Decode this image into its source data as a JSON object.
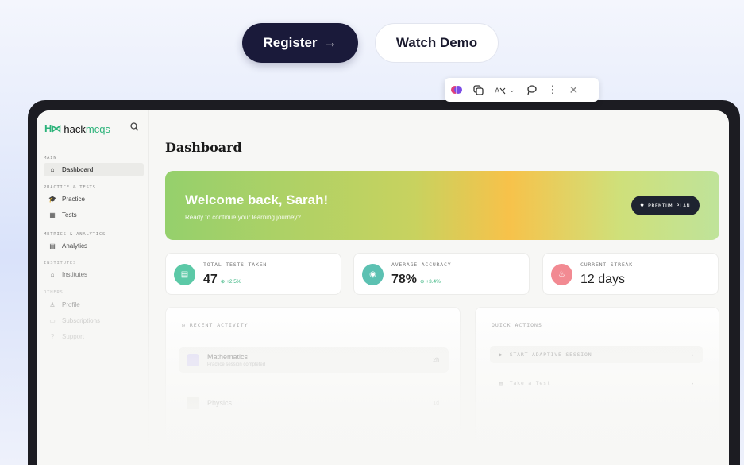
{
  "hero": {
    "register_label": "Register",
    "register_arrow": "→",
    "watch_demo_label": "Watch Demo"
  },
  "toolbar": {
    "icons": [
      "brain-icon",
      "copy-icon",
      "translate-icon",
      "chevron-down-icon",
      "lasso-icon",
      "more-icon",
      "close-icon"
    ]
  },
  "app": {
    "logo_mark": "H⋈",
    "logo_name_a": "hack",
    "logo_name_b": "mcqs",
    "sidebar": {
      "sections": {
        "main": "MAIN",
        "practice": "PRACTICE & TESTS",
        "metrics": "METRICS & ANALYTICS",
        "institutes": "INSTITUTES",
        "others": "OTHERS"
      },
      "items": {
        "dashboard": "Dashboard",
        "practice": "Practice",
        "tests": "Tests",
        "analytics": "Analytics",
        "institutes": "Institutes",
        "profile": "Profile",
        "subscriptions": "Subscriptions",
        "support": "Support"
      }
    },
    "page_title": "Dashboard",
    "welcome": {
      "title": "Welcome back, Sarah!",
      "subtitle": "Ready to continue your learning journey?",
      "plan_badge": "PREMIUM PLAN"
    },
    "stats": [
      {
        "label": "TOTAL TESTS TAKEN",
        "value": "47",
        "delta": "+2.5%%",
        "color": "#5cc9a7"
      },
      {
        "label": "AVERAGE ACCURACY",
        "value": "78%",
        "delta": "+3.4%%",
        "color": "#5cc1b2"
      },
      {
        "label": "CURRENT STREAK",
        "value": "12 days",
        "delta": "",
        "color": "#f28a92"
      }
    ],
    "recent_activity": {
      "title": "RECENT ACTIVITY",
      "rows": [
        {
          "subject": "Mathematics",
          "detail": "Practice session completed",
          "time": "2h"
        },
        {
          "subject": "Physics",
          "detail": "",
          "time": "1d"
        }
      ]
    },
    "quick_actions": {
      "title": "QUICK ACTIONS",
      "items": [
        "START ADAPTIVE SESSION",
        "Take a Test"
      ]
    }
  }
}
